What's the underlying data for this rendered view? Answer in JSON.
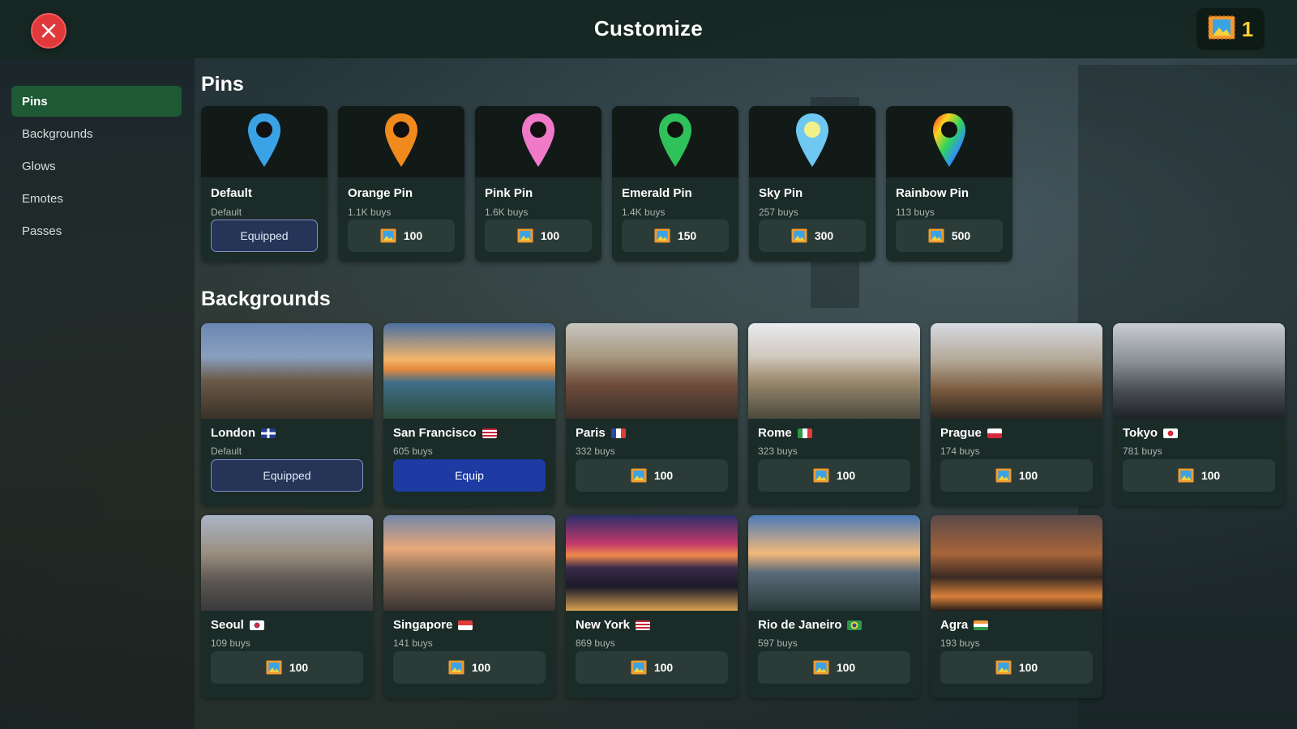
{
  "header": {
    "title": "Customize",
    "close_icon": "close-icon",
    "currency_icon": "stamp-icon",
    "currency_count": "1"
  },
  "sidebar": {
    "items": [
      {
        "label": "Pins",
        "active": true
      },
      {
        "label": "Backgrounds",
        "active": false
      },
      {
        "label": "Glows",
        "active": false
      },
      {
        "label": "Emotes",
        "active": false
      },
      {
        "label": "Passes",
        "active": false
      }
    ]
  },
  "sections": {
    "pins_title": "Pins",
    "backgrounds_title": "Backgrounds"
  },
  "pins": [
    {
      "name": "Default",
      "sub": "Default",
      "button": "Equipped",
      "state": "equipped",
      "color": "#3aa3e6"
    },
    {
      "name": "Orange Pin",
      "sub": "1.1K buys",
      "button": "100",
      "state": "price",
      "color": "#f08a1c"
    },
    {
      "name": "Pink Pin",
      "sub": "1.6K buys",
      "button": "100",
      "state": "price",
      "color": "#f07ac8"
    },
    {
      "name": "Emerald Pin",
      "sub": "1.4K buys",
      "button": "150",
      "state": "price",
      "color": "#2fc15a"
    },
    {
      "name": "Sky Pin",
      "sub": "257 buys",
      "button": "300",
      "state": "price",
      "color": "#6ec8f2"
    },
    {
      "name": "Rainbow Pin",
      "sub": "113 buys",
      "button": "500",
      "state": "price",
      "color": "rainbow"
    }
  ],
  "backgrounds": [
    {
      "name": "London",
      "flag": "uk-flag",
      "sub": "Default",
      "button": "Equipped",
      "state": "equipped"
    },
    {
      "name": "San Francisco",
      "flag": "us-flag",
      "sub": "605 buys",
      "button": "Equip",
      "state": "equip"
    },
    {
      "name": "Paris",
      "flag": "fr-flag",
      "sub": "332 buys",
      "button": "100",
      "state": "price"
    },
    {
      "name": "Rome",
      "flag": "it-flag",
      "sub": "323 buys",
      "button": "100",
      "state": "price"
    },
    {
      "name": "Prague",
      "flag": "cz-flag",
      "sub": "174 buys",
      "button": "100",
      "state": "price"
    },
    {
      "name": "Tokyo",
      "flag": "jp-flag",
      "sub": "781 buys",
      "button": "100",
      "state": "price"
    },
    {
      "name": "Seoul",
      "flag": "kr-flag",
      "sub": "109 buys",
      "button": "100",
      "state": "price"
    },
    {
      "name": "Singapore",
      "flag": "sg-flag",
      "sub": "141 buys",
      "button": "100",
      "state": "price"
    },
    {
      "name": "New York",
      "flag": "us-flag",
      "sub": "869 buys",
      "button": "100",
      "state": "price"
    },
    {
      "name": "Rio de Janeiro",
      "flag": "br-flag",
      "sub": "597 buys",
      "button": "100",
      "state": "price"
    },
    {
      "name": "Agra",
      "flag": "in-flag",
      "sub": "193 buys",
      "button": "100",
      "state": "price"
    }
  ],
  "colors": {
    "accent_green": "#1d5a35",
    "equip_blue": "#1e3aa3",
    "close_red": "#e0393b",
    "currency_gold": "#ffd12a"
  }
}
